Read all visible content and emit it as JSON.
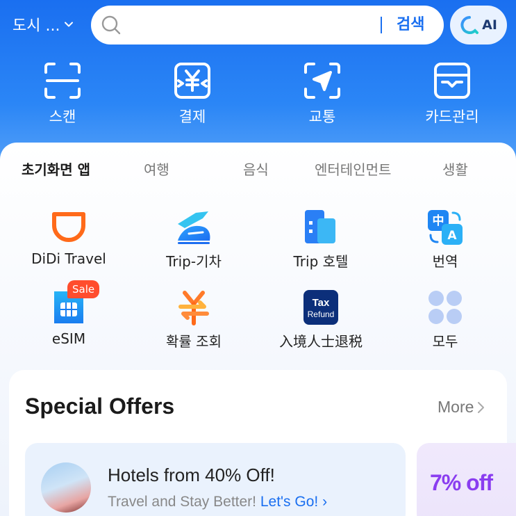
{
  "header": {
    "city_label": "도시 ...",
    "search_button": "검색",
    "ai_label": "AI"
  },
  "quick_actions": [
    {
      "label": "스캔",
      "icon": "scan-icon"
    },
    {
      "label": "결제",
      "icon": "yen-payment-icon"
    },
    {
      "label": "교통",
      "icon": "navigation-arrow-icon"
    },
    {
      "label": "카드관리",
      "icon": "wallet-icon"
    }
  ],
  "tabs": [
    "초기화면 앱",
    "여행",
    "음식",
    "엔터테인먼트",
    "생활"
  ],
  "apps_row1": [
    {
      "label": "DiDi Travel",
      "icon": "didi-icon"
    },
    {
      "label": "Trip-기차",
      "icon": "train-icon"
    },
    {
      "label": "Trip 호텔",
      "icon": "hotel-icon"
    },
    {
      "label": "번역",
      "icon": "translate-icon"
    }
  ],
  "apps_row2": [
    {
      "label": "eSIM",
      "icon": "esim-icon",
      "badge": "Sale"
    },
    {
      "label": "확률 조회",
      "icon": "exchange-rate-icon"
    },
    {
      "label": "入境人士退税",
      "icon": "tax-refund-icon",
      "icon_text": [
        "Tax",
        "Refund"
      ]
    },
    {
      "label": "모두",
      "icon": "all-apps-icon"
    }
  ],
  "offers": {
    "title": "Special Offers",
    "more": "More",
    "card_title": "Hotels from 40% Off!",
    "card_sub": "Travel and Stay Better!",
    "card_link": "Let's Go!",
    "side_text": "7% off"
  },
  "colors": {
    "brand_blue": "#1a6ff0",
    "sale_red": "#ff4d2d",
    "didi_orange": "#ff6a1a",
    "promo_purple": "#8a3df0"
  }
}
